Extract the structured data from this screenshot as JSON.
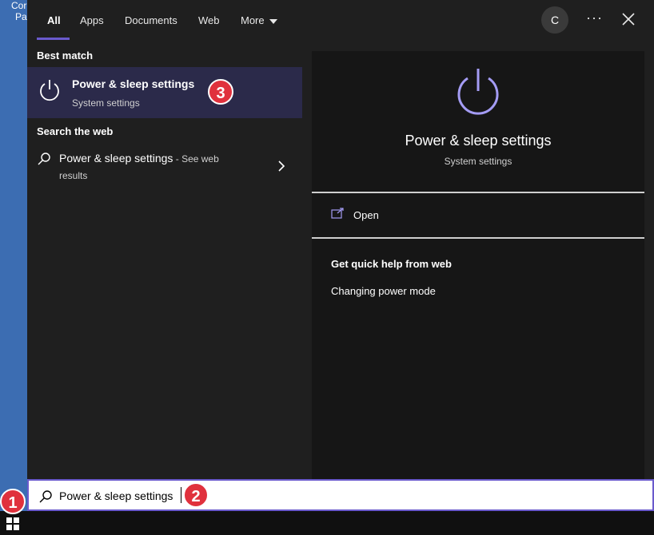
{
  "desktop": {
    "label_line1": "Cor",
    "label_line2": "Pa"
  },
  "tabs": [
    {
      "label": "All"
    },
    {
      "label": "Apps"
    },
    {
      "label": "Documents"
    },
    {
      "label": "Web"
    },
    {
      "label": "More"
    }
  ],
  "header": {
    "avatar_initial": "C",
    "more_options_label": "···"
  },
  "results": {
    "best_match_heading": "Best match",
    "best_match": {
      "title": "Power & sleep settings",
      "subtitle": "System settings",
      "icon": "power-icon"
    },
    "web_heading": "Search the web",
    "web_item": {
      "title": "Power & sleep settings",
      "suffix": " - See web",
      "suffix2": "results",
      "icon": "search-icon"
    }
  },
  "detail": {
    "title": "Power & sleep settings",
    "subtitle": "System settings",
    "open_label": "Open",
    "help_heading": "Get quick help from web",
    "help_link": "Changing power mode"
  },
  "search": {
    "query": "Power & sleep settings"
  },
  "badges": {
    "b1": "1",
    "b2": "2",
    "b3": "3"
  },
  "colors": {
    "accent": "#6a5acd",
    "selection": "#2b2a4a",
    "badge": "#e0313d",
    "power_icon": "#a49cf4"
  }
}
